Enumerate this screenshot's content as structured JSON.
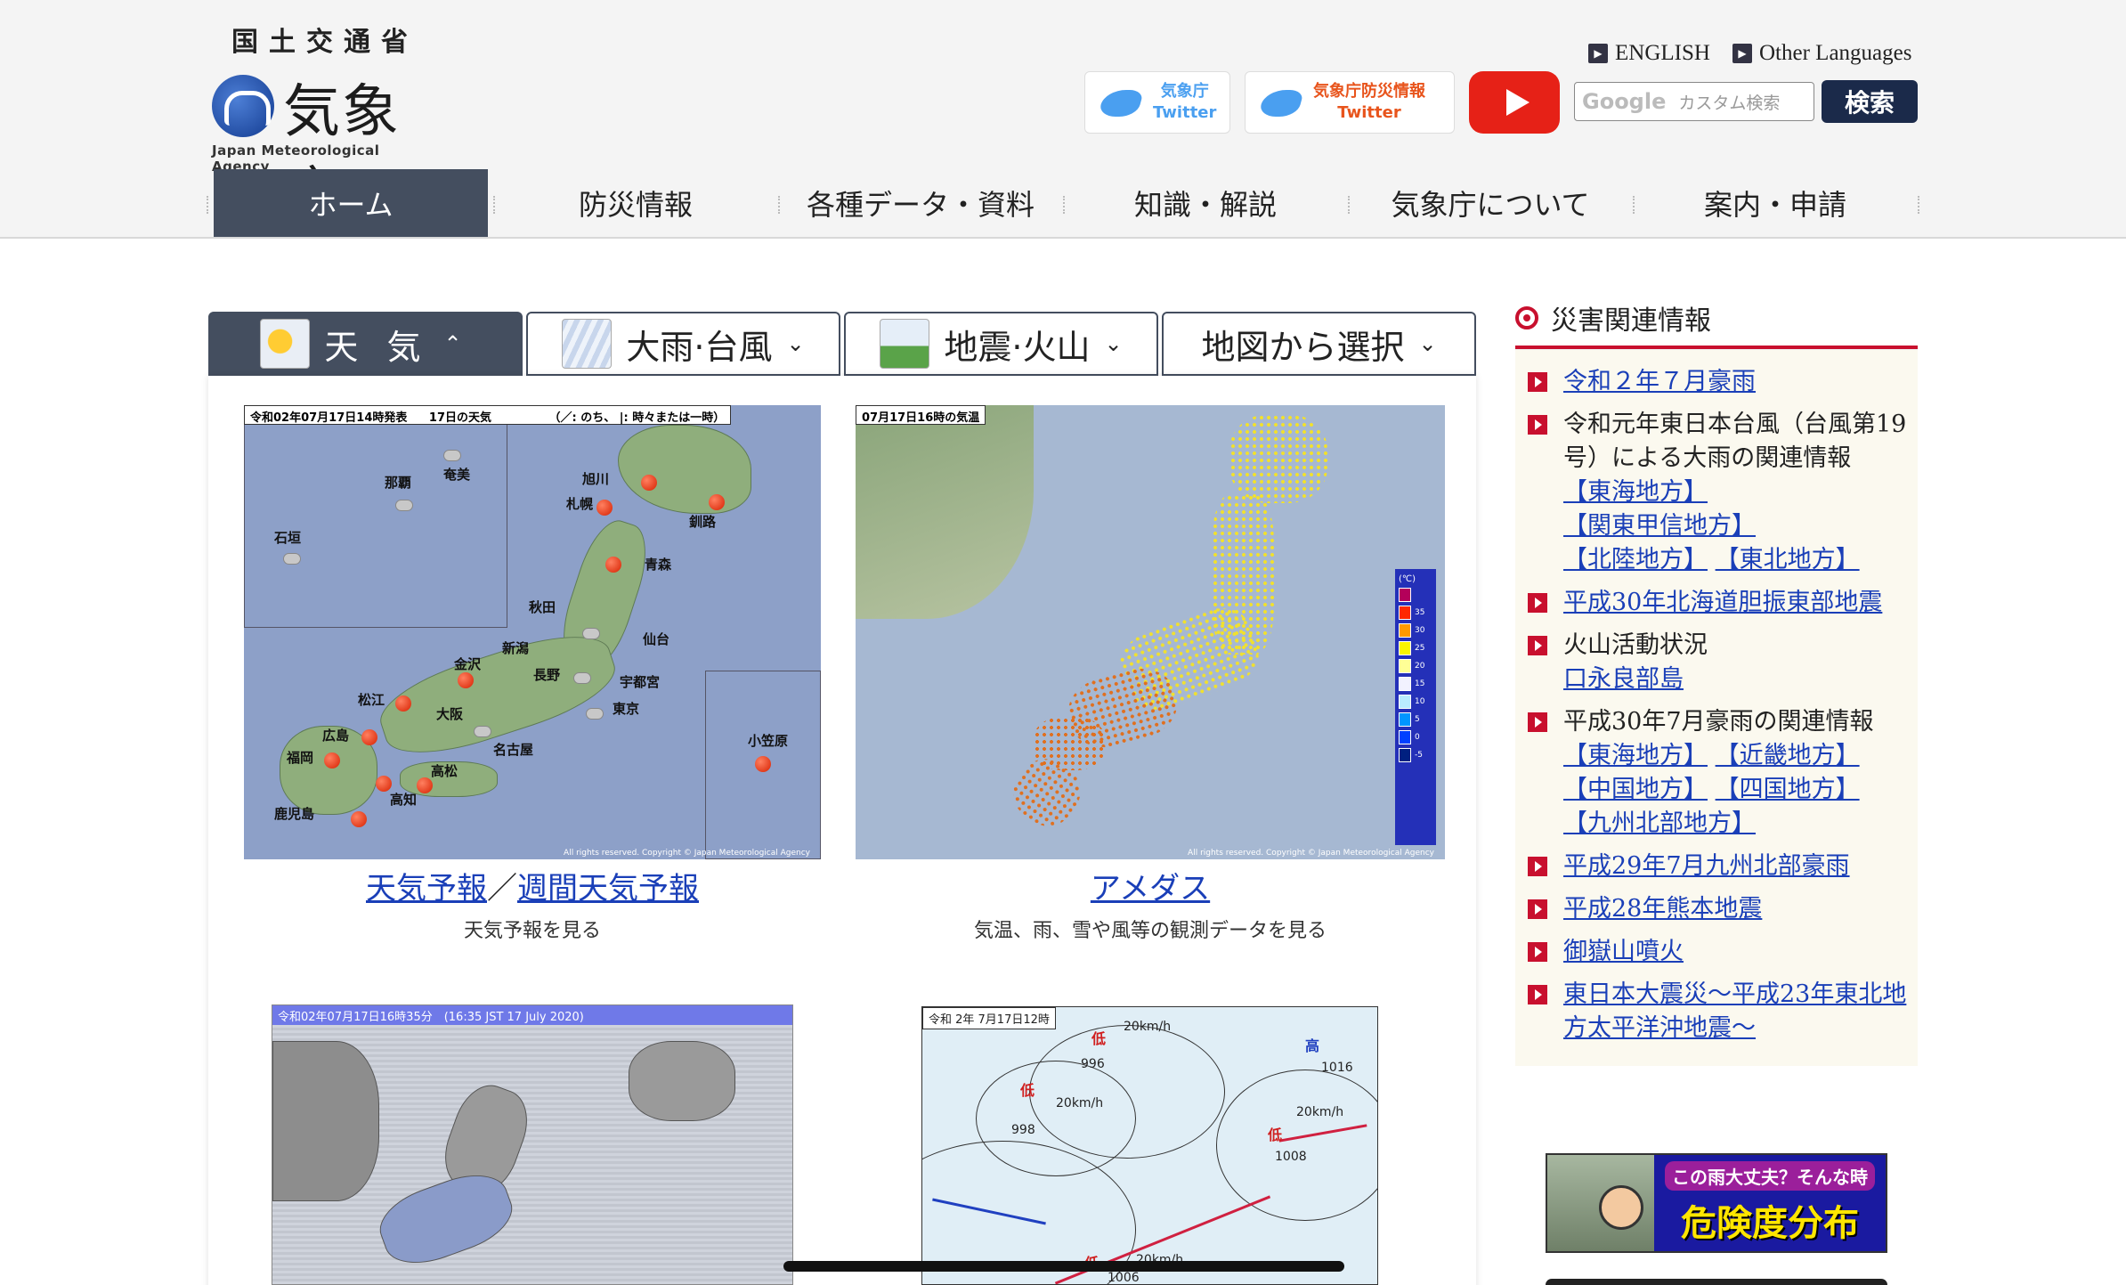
{
  "header": {
    "ministry": "国土交通省",
    "agency_name": "気象庁",
    "agency_name_en": "Japan Meteorological Agency",
    "lang_english": "ENGLISH",
    "lang_other": "Other Languages",
    "twitter1_l1": "気象庁",
    "twitter1_l2": "Twitter",
    "twitter2_l1": "気象庁防災情報",
    "twitter2_l2": "Twitter",
    "search_placeholder": "カスタム検索",
    "search_google": "Google",
    "search_button": "検索"
  },
  "nav": {
    "items": [
      "ホーム",
      "防災情報",
      "各種データ・資料",
      "知識・解説",
      "気象庁について",
      "案内・申請"
    ],
    "active_index": 0
  },
  "tabs": {
    "weather": "天 気",
    "heavy_rain": "大雨·台風",
    "earthquake": "地震·火山",
    "map_select": "地図から選択",
    "chevron_up": "⌃",
    "chevron_down": "⌄"
  },
  "forecast_map": {
    "header_left": "令和02年07月17日14時発表",
    "header_mid": "17日の天気",
    "header_right": "（／: のち、 |: 時々または一時）",
    "cities": [
      "奄美",
      "那覇",
      "石垣",
      "旭川",
      "札幌",
      "釧路",
      "青森",
      "秋田",
      "仙台",
      "新潟",
      "金沢",
      "長野",
      "宇都宮",
      "東京",
      "松江",
      "大阪",
      "広島",
      "名古屋",
      "福岡",
      "高松",
      "高知",
      "鹿児島",
      "小笠原"
    ],
    "copyright": "All rights reserved. Copyright © Japan Meteorological Agency"
  },
  "amedas_map": {
    "header": "07月17日16時の気温",
    "legend_unit": "(℃)",
    "legend_values": [
      "35",
      "30",
      "25",
      "20",
      "15",
      "10",
      "5",
      "0",
      "-5"
    ],
    "legend_colors": [
      "#b4005a",
      "#ff2800",
      "#ff9900",
      "#faf500",
      "#ffff96",
      "#f2f2ff",
      "#b9ebff",
      "#0096ff",
      "#0041ff",
      "#002080"
    ],
    "copyright": "All rights reserved. Copyright © Japan Meteorological Agency"
  },
  "captions": {
    "forecast_link1": "天気予報",
    "forecast_sep": "／",
    "forecast_link2": "週間天気予報",
    "forecast_sub": "天気予報を見る",
    "amedas_link": "アメダス",
    "amedas_sub": "気温、雨、雪や風等の観測データを見る"
  },
  "radar_map": {
    "header": "令和02年07月17日16時35分　(16:35 JST 17 July 2020)"
  },
  "weather_chart": {
    "header": "令和 2年 7月17日12時",
    "labels": [
      "低",
      "996",
      "20km/h",
      "低",
      "20km/h",
      "998",
      "高",
      "1016",
      "低",
      "20km/h",
      "1008",
      "1006",
      "20km/h",
      "低"
    ]
  },
  "sidebar": {
    "title": "災害関連情報",
    "items": [
      {
        "link": "令和２年７月豪雨"
      },
      {
        "text": "令和元年東日本台風（台風第19号）による大雨の関連情報",
        "links": [
          "【東海地方】",
          "【関東甲信地方】",
          "【北陸地方】",
          "【東北地方】"
        ]
      },
      {
        "link": "平成30年北海道胆振東部地震"
      },
      {
        "text": "火山活動状況",
        "links": [
          "口永良部島"
        ]
      },
      {
        "text": "平成30年7月豪雨の関連情報",
        "links": [
          "【東海地方】",
          "【近畿地方】",
          "【中国地方】",
          "【四国地方】",
          "【九州北部地方】"
        ]
      },
      {
        "link": "平成29年7月九州北部豪雨"
      },
      {
        "link": "平成28年熊本地震"
      },
      {
        "link": "御嶽山噴火"
      },
      {
        "link": "東日本大震災～平成23年東北地方太平洋沖地震～"
      }
    ]
  },
  "banner": {
    "question": "この雨大丈夫？そんな時",
    "title": "危険度分布"
  }
}
